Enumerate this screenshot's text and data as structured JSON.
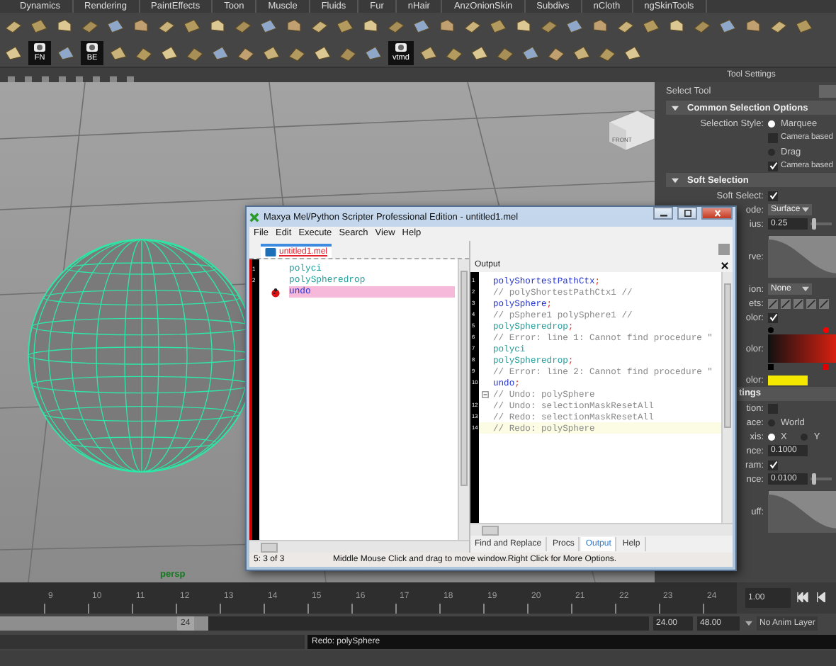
{
  "menu_tabs": [
    "Dynamics",
    "Rendering",
    "PaintEffects",
    "Toon",
    "Muscle",
    "Fluids",
    "Fur",
    "nHair",
    "AnzOnionSkin",
    "Subdivs",
    "nCloth",
    "ngSkinTools"
  ],
  "shelf": {
    "labels": [
      "FN",
      "BE",
      "vtmd"
    ]
  },
  "viewport": {
    "camera": "persp",
    "view_cube": "FRONT"
  },
  "tool_settings": {
    "title": "Tool Settings",
    "tool": "Select Tool",
    "rows": [
      {
        "kind": "header",
        "label": "Common Selection Options"
      },
      {
        "kind": "radio",
        "label": "Selection Style:",
        "options": [
          {
            "label": "Marquee",
            "selected": true
          }
        ]
      },
      {
        "kind": "check",
        "text": "Camera based",
        "checked": false
      },
      {
        "kind": "radio",
        "options": [
          {
            "label": "Drag",
            "selected": false
          }
        ]
      },
      {
        "kind": "check",
        "text": "Camera based",
        "checked": true
      },
      {
        "kind": "header",
        "label": "Soft Selection"
      },
      {
        "kind": "check",
        "label": "Soft Select:",
        "checked": true
      },
      {
        "kind": "dropdown",
        "label": "ode:",
        "value": "Surface"
      },
      {
        "kind": "field",
        "label": "ius:",
        "value": "0.25",
        "level": 0.05
      },
      {
        "kind": "curve",
        "label": "rve:"
      },
      {
        "kind": "dropdown",
        "label": "ion:",
        "value": "None"
      },
      {
        "kind": "presets",
        "label": "ets:"
      },
      {
        "kind": "check",
        "label": "olor:",
        "checked": true
      },
      {
        "kind": "gradient",
        "label": "olor:"
      },
      {
        "kind": "swatch",
        "label": "olor:",
        "color": "#f5e800"
      },
      {
        "kind": "section",
        "label": "tings"
      },
      {
        "kind": "check",
        "label": "tion:",
        "checked": false
      },
      {
        "kind": "radio",
        "label": "ace:",
        "options": [
          {
            "label": "World",
            "selected": false
          }
        ]
      },
      {
        "kind": "radio",
        "label": "xis:",
        "options": [
          {
            "label": "X",
            "selected": true
          },
          {
            "label": "Y",
            "selected": false
          }
        ]
      },
      {
        "kind": "field",
        "label": "nce:",
        "value": "0.1000"
      },
      {
        "kind": "check",
        "label": "ram:",
        "checked": true
      },
      {
        "kind": "field",
        "label": "nce:",
        "value": "0.0100",
        "level": 0.05
      },
      {
        "kind": "curve",
        "label": "uff:"
      }
    ]
  },
  "script_window": {
    "title": "Maxya Mel/Python Scripter Professional Edition - untitled1.mel",
    "menu": [
      "File",
      "Edit",
      "Execute",
      "Search",
      "View",
      "Help"
    ],
    "editor": {
      "tab": {
        "label": "untitled1.mel",
        "selected": true
      },
      "lines": [
        {
          "number": "1",
          "text": "polyci",
          "kind": "call",
          "highlighted": false,
          "breakpoint": false
        },
        {
          "number": "2",
          "text": "polySpheredrop",
          "kind": "call",
          "highlighted": false,
          "breakpoint": false
        },
        {
          "text": "undo",
          "kind": "command",
          "highlighted": true,
          "breakpoint": true
        }
      ]
    },
    "output": {
      "title": "Output",
      "lines": [
        {
          "number": "1",
          "text": "polyShortestPathCtx",
          "terminator": ";",
          "kind": "command",
          "fold": false,
          "highlighted": false
        },
        {
          "number": "2",
          "text": "// polyShortestPathCtx1 //",
          "kind": "comment",
          "fold": false,
          "highlighted": false
        },
        {
          "number": "3",
          "text": "polySphere",
          "terminator": ";",
          "kind": "command",
          "fold": false,
          "highlighted": false
        },
        {
          "number": "4",
          "text": "// pSphere1 polySphere1 //",
          "kind": "comment",
          "fold": false,
          "highlighted": false
        },
        {
          "number": "5",
          "text": "polySpheredrop",
          "terminator": ";",
          "kind": "call",
          "fold": false,
          "highlighted": false
        },
        {
          "number": "6",
          "text": "// Error: line 1: Cannot find procedure \"",
          "kind": "comment",
          "fold": false,
          "highlighted": false
        },
        {
          "number": "7",
          "text": "polyci",
          "kind": "call",
          "fold": false,
          "highlighted": false
        },
        {
          "number": "8",
          "text": "polySpheredrop",
          "terminator": ";",
          "kind": "call",
          "fold": false,
          "highlighted": false
        },
        {
          "number": "9",
          "text": "// Error: line 2: Cannot find procedure \"",
          "kind": "comment",
          "fold": false,
          "highlighted": false
        },
        {
          "number": "10",
          "text": "undo",
          "terminator": ";",
          "kind": "command",
          "fold": false,
          "highlighted": false
        },
        {
          "text": "// Undo: polySphere",
          "kind": "comment",
          "fold": true,
          "highlighted": false
        },
        {
          "number": "12",
          "text": "// Undo: selectionMaskResetAll",
          "kind": "comment",
          "fold": false,
          "highlighted": false
        },
        {
          "number": "13",
          "text": "// Redo: selectionMaskResetAll",
          "kind": "comment",
          "fold": false,
          "highlighted": false
        },
        {
          "number": "14",
          "text": "// Redo: polySphere",
          "kind": "comment",
          "fold": false,
          "highlighted": true
        }
      ]
    },
    "tabs": [
      {
        "label": "Find and Replace",
        "selected": false
      },
      {
        "label": "Procs",
        "selected": false
      },
      {
        "label": "Output",
        "selected": true
      },
      {
        "label": "Help",
        "selected": false
      }
    ],
    "status": {
      "position": "5: 3 of 3",
      "message": "Middle Mouse Click and drag to move window.Right Click for More Options."
    }
  },
  "timeline": {
    "frames": [
      "9",
      "10",
      "11",
      "12",
      "13",
      "14",
      "15",
      "16",
      "17",
      "18",
      "19",
      "20",
      "21",
      "22",
      "23",
      "24"
    ],
    "current": "1.00"
  },
  "range": {
    "level": 0.32,
    "handle": "24",
    "start": "24.00",
    "end": "48.00",
    "anim_layer": "No Anim Layer"
  },
  "command_line": {
    "result": "Redo: polySphere"
  }
}
